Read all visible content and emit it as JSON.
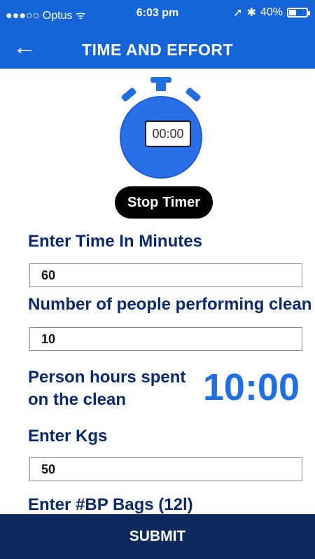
{
  "status_bar": {
    "carrier": "●●●○○ Optus",
    "time": "6:03 pm",
    "battery": "40%"
  },
  "nav": {
    "title": "TIME AND EFFORT",
    "back_icon": "arrow-left-icon"
  },
  "stopwatch": {
    "display": "00:00",
    "icon": "stopwatch-icon"
  },
  "stop_timer_label": "Stop Timer",
  "form": {
    "time_label": "Enter Time In Minutes",
    "time_value": "60",
    "people_label": "Number of people performing clean",
    "people_value": "10",
    "hours_label_line1": "Person hours spent",
    "hours_label_line2": "on the clean",
    "hours_value": "10:00",
    "kgs_label": "Enter Kgs",
    "kgs_value": "50",
    "bags_label": "Enter #BP Bags (12l)"
  },
  "submit_label": "SUBMIT",
  "colors": {
    "primary": "#1565d8",
    "label": "#0a2a6c",
    "footer": "#0c2a5b",
    "accent_value": "#1f6fe0"
  }
}
